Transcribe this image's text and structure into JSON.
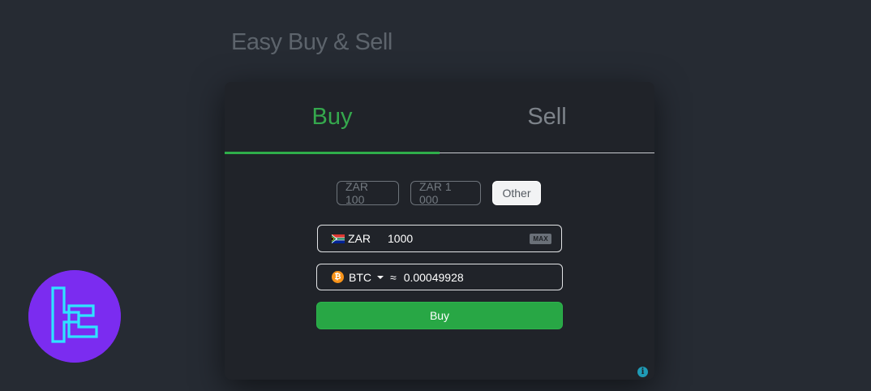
{
  "page": {
    "title": "Easy Buy & Sell"
  },
  "tabs": [
    {
      "label": "Buy",
      "active": true
    },
    {
      "label": "Sell",
      "active": false
    }
  ],
  "presets": [
    {
      "label": "ZAR 100"
    },
    {
      "label": "ZAR 1 000"
    },
    {
      "label": "Other",
      "selected": true
    }
  ],
  "fiat_field": {
    "currency": "ZAR",
    "value": "1000",
    "max_label": "MAX",
    "flag_icon": "south-africa-flag-icon"
  },
  "crypto_field": {
    "currency": "BTC",
    "approx_symbol": "≈",
    "value": "0.00049928",
    "coin_icon": "bitcoin-icon",
    "coin_glyph": "₿"
  },
  "action": {
    "buy_label": "Buy"
  },
  "info": {
    "icon": "info-icon",
    "glyph": "i"
  },
  "colors": {
    "accent_green": "#28a745",
    "background": "#262b33",
    "card": "#202329",
    "logo_purple": "#7b2cf0",
    "logo_cyan": "#2fe3ff"
  }
}
